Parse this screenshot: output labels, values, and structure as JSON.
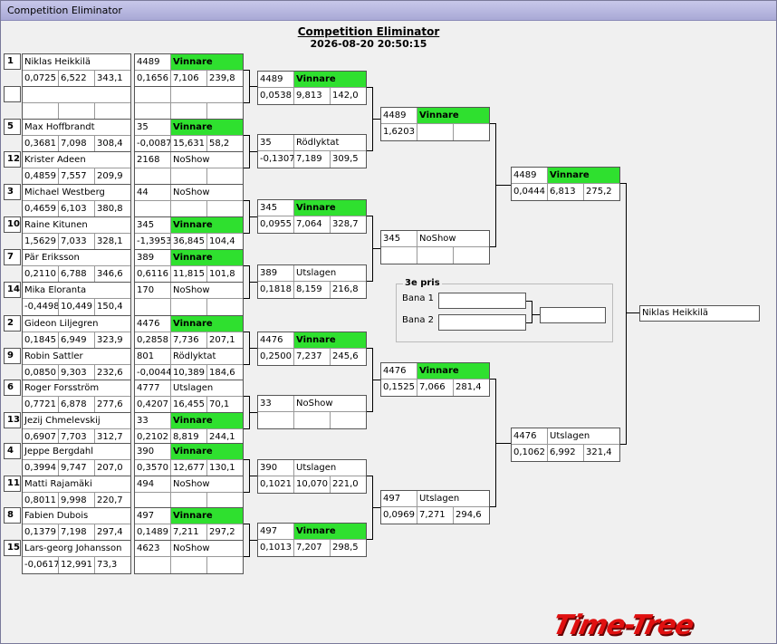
{
  "window": {
    "title": "Competition Eliminator"
  },
  "header": {
    "title": "Competition Eliminator",
    "timestamp": "2026-08-20 20:50:15"
  },
  "round1": [
    {
      "seed": "1",
      "name": "Niklas Heikkilä",
      "rt": "0,0725",
      "et": "6,522",
      "mph": "343,1",
      "nr": "4489",
      "res": "Vinnare",
      "win": true,
      "rt2": "0,1656",
      "et2": "7,106",
      "mph2": "239,8"
    },
    {
      "seed": "",
      "name": "",
      "rt": "",
      "et": "",
      "mph": "",
      "nr": "",
      "res": "",
      "win": false,
      "rt2": "",
      "et2": "",
      "mph2": ""
    },
    {
      "seed": "5",
      "name": "Max Hoffbrandt",
      "rt": "0,3681",
      "et": "7,098",
      "mph": "308,4",
      "nr": "35",
      "res": "Vinnare",
      "win": true,
      "rt2": "-0,0087",
      "et2": "15,631",
      "mph2": "58,2"
    },
    {
      "seed": "12",
      "name": "Krister Adeen",
      "rt": "0,4859",
      "et": "7,557",
      "mph": "209,9",
      "nr": "2168",
      "res": "NoShow",
      "win": false,
      "rt2": "",
      "et2": "",
      "mph2": ""
    },
    {
      "seed": "3",
      "name": "Michael Westberg",
      "rt": "0,4659",
      "et": "6,103",
      "mph": "380,8",
      "nr": "44",
      "res": "NoShow",
      "win": false,
      "rt2": "",
      "et2": "",
      "mph2": ""
    },
    {
      "seed": "10",
      "name": "Raine Kitunen",
      "rt": "1,5629",
      "et": "7,033",
      "mph": "328,1",
      "nr": "345",
      "res": "Vinnare",
      "win": true,
      "rt2": "-1,3953",
      "et2": "36,845",
      "mph2": "104,4"
    },
    {
      "seed": "7",
      "name": "Pär Eriksson",
      "rt": "0,2110",
      "et": "6,788",
      "mph": "346,6",
      "nr": "389",
      "res": "Vinnare",
      "win": true,
      "rt2": "0,6116",
      "et2": "11,815",
      "mph2": "101,8"
    },
    {
      "seed": "14",
      "name": "Mika Eloranta",
      "rt": "-0,4498",
      "et": "10,449",
      "mph": "150,4",
      "nr": "170",
      "res": "NoShow",
      "win": false,
      "rt2": "",
      "et2": "",
      "mph2": ""
    },
    {
      "seed": "2",
      "name": "Gideon Liljegren",
      "rt": "0,1845",
      "et": "6,949",
      "mph": "323,9",
      "nr": "4476",
      "res": "Vinnare",
      "win": true,
      "rt2": "0,2858",
      "et2": "7,736",
      "mph2": "207,1"
    },
    {
      "seed": "9",
      "name": "Robin Sattler",
      "rt": "0,0850",
      "et": "9,303",
      "mph": "232,6",
      "nr": "801",
      "res": "Rödlyktat",
      "win": false,
      "rt2": "-0,0044",
      "et2": "10,389",
      "mph2": "184,6"
    },
    {
      "seed": "6",
      "name": "Roger Forsström",
      "rt": "0,7721",
      "et": "6,878",
      "mph": "277,6",
      "nr": "4777",
      "res": "Utslagen",
      "win": false,
      "rt2": "0,4207",
      "et2": "16,455",
      "mph2": "70,1"
    },
    {
      "seed": "13",
      "name": "Jezij  Chmelevskij",
      "rt": "0,6907",
      "et": "7,703",
      "mph": "312,7",
      "nr": "33",
      "res": "Vinnare",
      "win": true,
      "rt2": "0,2102",
      "et2": "8,819",
      "mph2": "244,1"
    },
    {
      "seed": "4",
      "name": "Jeppe Bergdahl",
      "rt": "0,3994",
      "et": "9,747",
      "mph": "207,0",
      "nr": "390",
      "res": "Vinnare",
      "win": true,
      "rt2": "0,3570",
      "et2": "12,677",
      "mph2": "130,1"
    },
    {
      "seed": "11",
      "name": "Matti Rajamäki",
      "rt": "0,8011",
      "et": "9,998",
      "mph": "220,7",
      "nr": "494",
      "res": "NoShow",
      "win": false,
      "rt2": "",
      "et2": "",
      "mph2": ""
    },
    {
      "seed": "8",
      "name": "Fabien  Dubois",
      "rt": "0,1379",
      "et": "7,198",
      "mph": "297,4",
      "nr": "497",
      "res": "Vinnare",
      "win": true,
      "rt2": "0,1489",
      "et2": "7,211",
      "mph2": "297,2"
    },
    {
      "seed": "15",
      "name": "Lars-georg Johansson",
      "rt": "-0,0617",
      "et": "12,991",
      "mph": "73,3",
      "nr": "4623",
      "res": "NoShow",
      "win": false,
      "rt2": "",
      "et2": "",
      "mph2": ""
    }
  ],
  "round2": [
    {
      "nr": "4489",
      "res": "Vinnare",
      "win": true,
      "rt": "0,0538",
      "et": "9,813",
      "mph": "142,0"
    },
    {
      "nr": "35",
      "res": "Rödlyktat",
      "win": false,
      "rt": "-0,1307",
      "et": "7,189",
      "mph": "309,5"
    },
    {
      "nr": "345",
      "res": "Vinnare",
      "win": true,
      "rt": "0,0955",
      "et": "7,064",
      "mph": "328,7"
    },
    {
      "nr": "389",
      "res": "Utslagen",
      "win": false,
      "rt": "0,1818",
      "et": "8,159",
      "mph": "216,8"
    },
    {
      "nr": "4476",
      "res": "Vinnare",
      "win": true,
      "rt": "0,2500",
      "et": "7,237",
      "mph": "245,6"
    },
    {
      "nr": "33",
      "res": "NoShow",
      "win": false,
      "rt": "",
      "et": "",
      "mph": ""
    },
    {
      "nr": "390",
      "res": "Utslagen",
      "win": false,
      "rt": "0,1021",
      "et": "10,070",
      "mph": "221,0"
    },
    {
      "nr": "497",
      "res": "Vinnare",
      "win": true,
      "rt": "0,1013",
      "et": "7,207",
      "mph": "298,5"
    }
  ],
  "round3": [
    {
      "nr": "4489",
      "res": "Vinnare",
      "win": true,
      "rt": "1,6203",
      "et": "",
      "mph": ""
    },
    {
      "nr": "345",
      "res": "NoShow",
      "win": false,
      "rt": "",
      "et": "",
      "mph": ""
    },
    {
      "nr": "4476",
      "res": "Vinnare",
      "win": true,
      "rt": "0,1525",
      "et": "7,066",
      "mph": "281,4"
    },
    {
      "nr": "497",
      "res": "Utslagen",
      "win": false,
      "rt": "0,0969",
      "et": "7,271",
      "mph": "294,6"
    }
  ],
  "round4": [
    {
      "nr": "4489",
      "res": "Vinnare",
      "win": true,
      "rt": "0,0444",
      "et": "6,813",
      "mph": "275,2"
    },
    {
      "nr": "4476",
      "res": "Utslagen",
      "win": false,
      "rt": "0,1062",
      "et": "6,992",
      "mph": "321,4"
    }
  ],
  "final": {
    "winner": "Niklas Heikkilä"
  },
  "third_place": {
    "title": "3e pris",
    "lane1": "Bana 1",
    "lane2": "Bana 2"
  },
  "logo": {
    "text": "Time-Tree",
    "color": "#e01010"
  },
  "colors": {
    "winner": "#2fe02f"
  }
}
